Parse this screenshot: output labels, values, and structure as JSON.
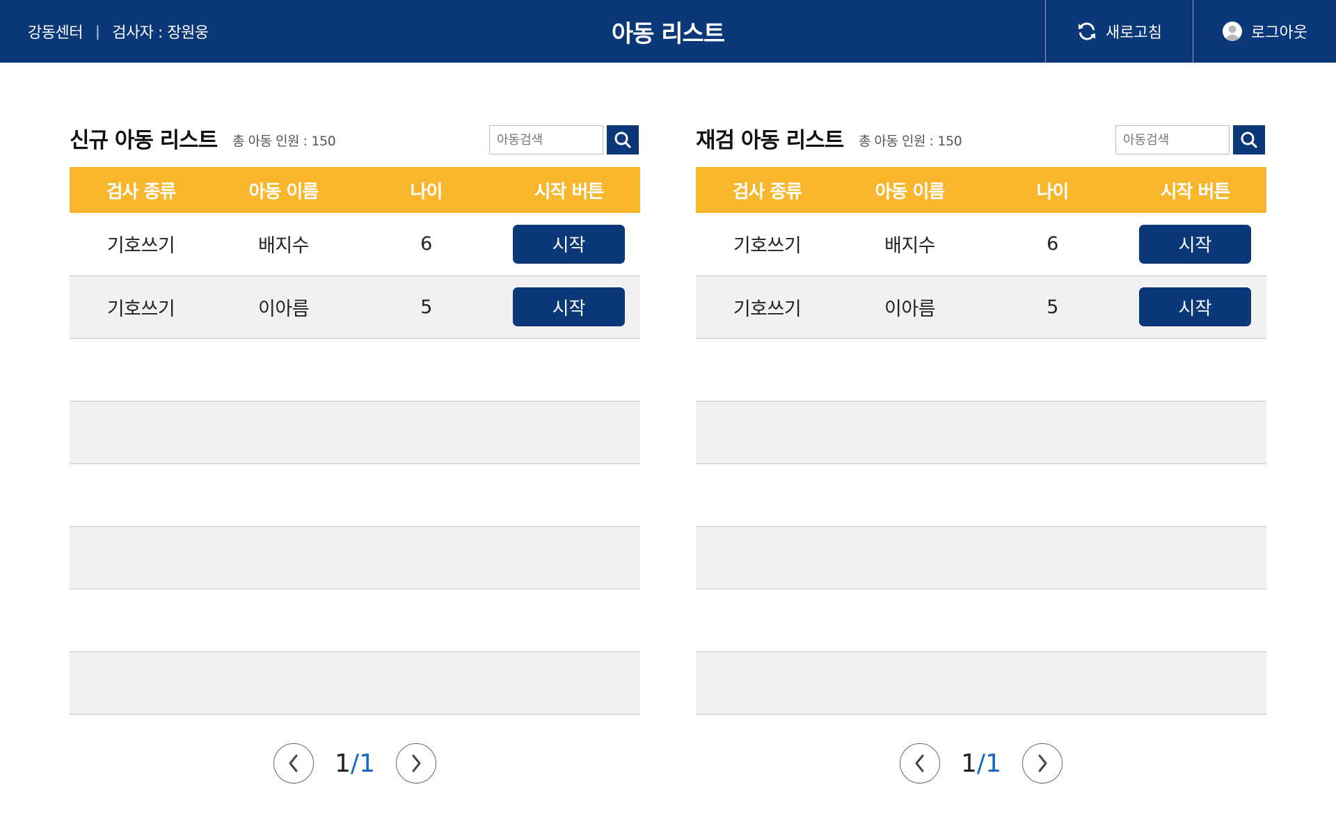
{
  "header": {
    "center_name": "강동센터",
    "separator": "|",
    "examiner": "검사자 : 장원웅",
    "title": "아동 리스트",
    "refresh_label": "새로고침",
    "logout_label": "로그아웃"
  },
  "columns": [
    "검사 종류",
    "아동 이름",
    "나이",
    "시작 버튼"
  ],
  "new_list": {
    "title": "신규 아동 리스트",
    "count_label": "총 아동 인원 :",
    "count_value": "150",
    "search_placeholder": "아동검색",
    "rows": [
      {
        "test_type": "기호쓰기",
        "name": "배지수",
        "age": "6",
        "start_label": "시작"
      },
      {
        "test_type": "기호쓰기",
        "name": "이아름",
        "age": "5",
        "start_label": "시작"
      }
    ],
    "page_current": "1",
    "page_separator": "/",
    "page_total": "1"
  },
  "retest_list": {
    "title": "재검 아동 리스트",
    "count_label": "총 아동 인원 :",
    "count_value": "150",
    "search_placeholder": "아동검색",
    "rows": [
      {
        "test_type": "기호쓰기",
        "name": "배지수",
        "age": "6",
        "start_label": "시작"
      },
      {
        "test_type": "기호쓰기",
        "name": "이아름",
        "age": "5",
        "start_label": "시작"
      }
    ],
    "page_current": "1",
    "page_separator": "/",
    "page_total": "1"
  },
  "colors": {
    "header_bg": "#0b3878",
    "table_header_bg": "#f7b62b",
    "button_bg": "#0b3878",
    "page_total_color": "#1467c8"
  }
}
